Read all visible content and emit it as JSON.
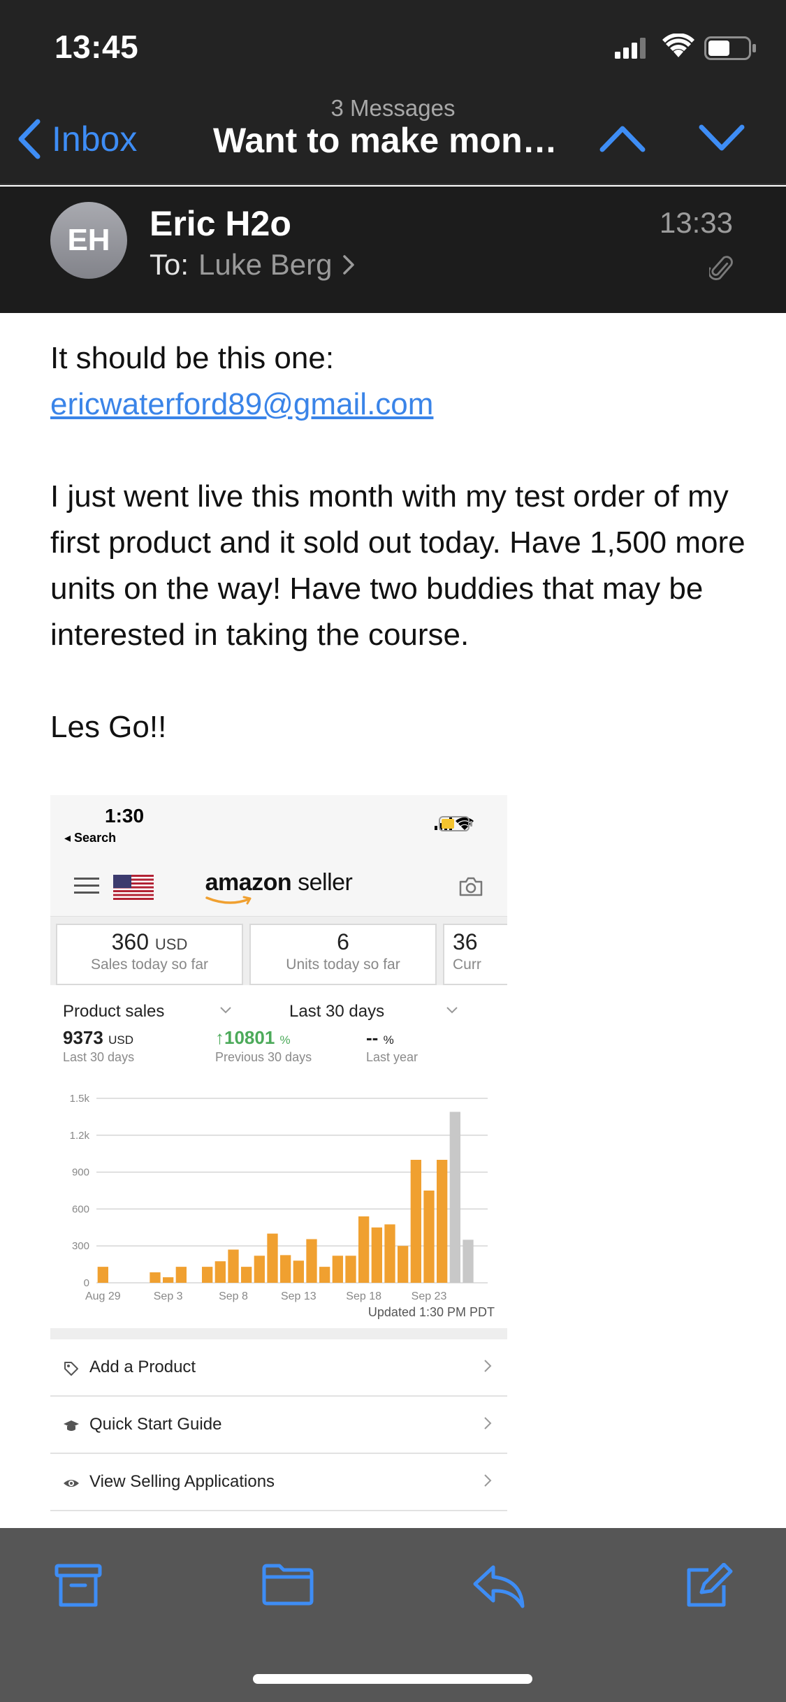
{
  "status_bar": {
    "time": "13:45"
  },
  "nav": {
    "back_label": "Inbox",
    "thread_count": "3 Messages",
    "subject": "Want to make money online"
  },
  "message": {
    "avatar_initials": "EH",
    "sender": "Eric H2o",
    "to_label": "To:",
    "recipient": "Luke Berg",
    "time": "13:33"
  },
  "body": {
    "line1": "It should be this one:",
    "email_link": "ericwaterford89@gmail.com",
    "para2": "I just went live this month with my test order of my first product and it sold out today. Have 1,500 more units on the way! Have two buddies that may be interested in taking the course.",
    "para3": "Les Go!!"
  },
  "screenshot": {
    "time": "1:30",
    "back_label": "◂ Search",
    "brand_bold": "amazon",
    "brand_rest": " seller",
    "kpis": [
      {
        "value": "360",
        "unit": "USD",
        "label": "Sales today so far"
      },
      {
        "value": "6",
        "unit": "",
        "label": "Units today so far"
      },
      {
        "value": "36",
        "unit": "",
        "label": "Curr"
      }
    ],
    "metric_select": "Product sales",
    "range_select": "Last 30 days",
    "stats": [
      {
        "value": "9373",
        "unit": "USD",
        "label": "Last 30 days",
        "arrow": ""
      },
      {
        "value": "10801",
        "unit": "%",
        "label": "Previous 30 days",
        "arrow": "↑"
      },
      {
        "value": "--",
        "unit": "%",
        "label": "Last year",
        "arrow": ""
      }
    ],
    "updated": "Updated 1:30 PM PDT",
    "links": [
      {
        "label": "Add a Product"
      },
      {
        "label": "Quick Start Guide"
      },
      {
        "label": "View Selling Applications"
      }
    ]
  },
  "chart_data": {
    "type": "bar",
    "title": "",
    "xlabel": "",
    "ylabel": "",
    "ylim": [
      0,
      1500
    ],
    "yticks": [
      0,
      300,
      600,
      900,
      1200,
      1500
    ],
    "ytick_labels": [
      "0",
      "300",
      "600",
      "900",
      "1.2k",
      "1.5k"
    ],
    "xtick_labels": [
      "Aug 29",
      "Sep 3",
      "Sep 8",
      "Sep 13",
      "Sep 18",
      "Sep 23"
    ],
    "grid": true,
    "categories": [
      "Aug 29",
      "Aug 30",
      "Aug 31",
      "Sep 1",
      "Sep 2",
      "Sep 3",
      "Sep 4",
      "Sep 5",
      "Sep 6",
      "Sep 7",
      "Sep 8",
      "Sep 9",
      "Sep 10",
      "Sep 11",
      "Sep 12",
      "Sep 13",
      "Sep 14",
      "Sep 15",
      "Sep 16",
      "Sep 17",
      "Sep 18",
      "Sep 19",
      "Sep 20",
      "Sep 21",
      "Sep 22",
      "Sep 23",
      "Sep 24",
      "Sep 25",
      "Sep 26",
      "Sep 27"
    ],
    "values": [
      130,
      0,
      0,
      0,
      85,
      45,
      130,
      0,
      130,
      175,
      270,
      130,
      220,
      400,
      225,
      180,
      355,
      130,
      220,
      220,
      540,
      450,
      475,
      300,
      1000,
      750,
      1000,
      1390,
      350,
      0
    ],
    "bar_colors": [
      "#f0a030",
      "#f0a030",
      "#f0a030",
      "#f0a030",
      "#f0a030",
      "#f0a030",
      "#f0a030",
      "#f0a030",
      "#f0a030",
      "#f0a030",
      "#f0a030",
      "#f0a030",
      "#f0a030",
      "#f0a030",
      "#f0a030",
      "#f0a030",
      "#f0a030",
      "#f0a030",
      "#f0a030",
      "#f0a030",
      "#f0a030",
      "#f0a030",
      "#f0a030",
      "#f0a030",
      "#f0a030",
      "#f0a030",
      "#f0a030",
      "#c8c8c8",
      "#c8c8c8",
      "#c8c8c8"
    ]
  },
  "colors": {
    "accent": "#3e8df5",
    "chart_bar": "#f0a030",
    "chart_bar_projected": "#c8c8c8"
  }
}
